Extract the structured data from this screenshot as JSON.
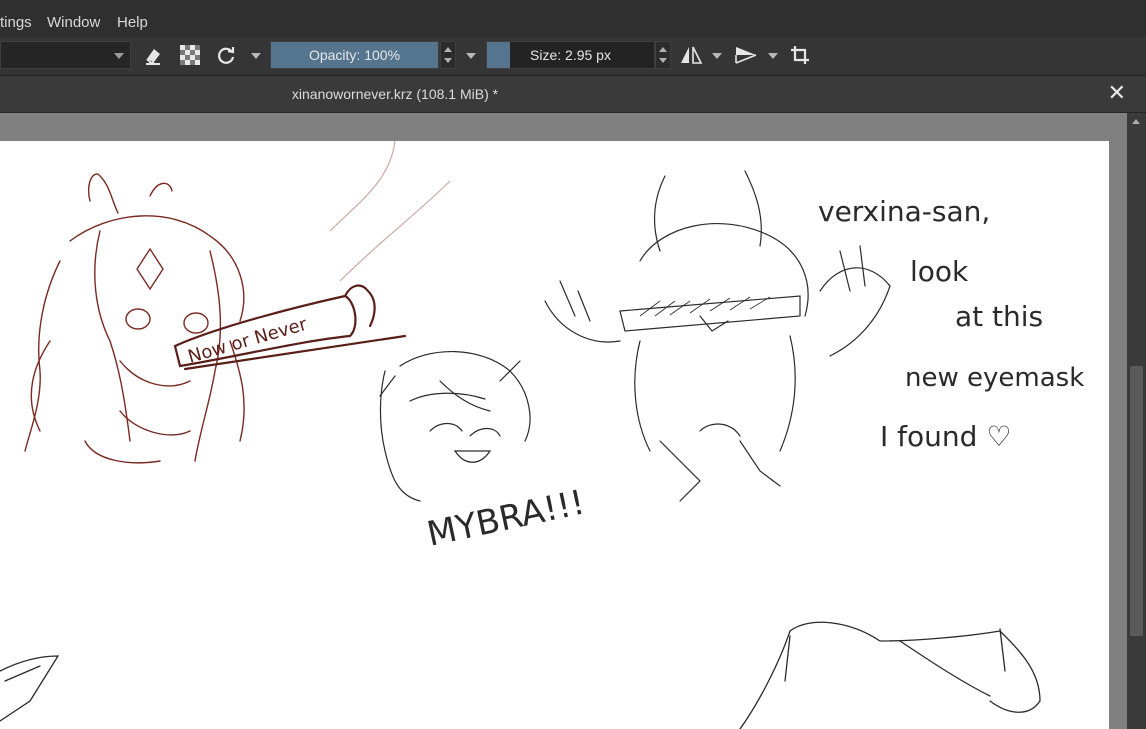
{
  "menu": {
    "items": [
      "tings",
      "Window",
      "Help"
    ]
  },
  "toolbar": {
    "opacity_label": "Opacity: 100%",
    "opacity_value": 100,
    "size_label": "Size: 2.95 px",
    "icons": [
      "eraser-icon",
      "checkerboard-icon",
      "reload-icon",
      "mirror-horizontal-icon",
      "mirror-vertical-icon",
      "crop-icon"
    ],
    "accent_color": "#55758f"
  },
  "tab": {
    "title": "xinanowornever.krz (108.1 MiB) *",
    "close_glyph": "✕"
  },
  "canvas": {
    "background": "#808080",
    "paper_color": "#ffffff",
    "sketch_texts": {
      "nowornever": "Now or Never",
      "mybra": "MYBRA!!!",
      "line1": "verxina-san,",
      "line2": "look",
      "line3": "at this",
      "line4": "new eyemask",
      "line5": "I found ♡"
    },
    "ink_colors": {
      "red": "#7a2a22",
      "dark": "#2a2a2a"
    }
  }
}
